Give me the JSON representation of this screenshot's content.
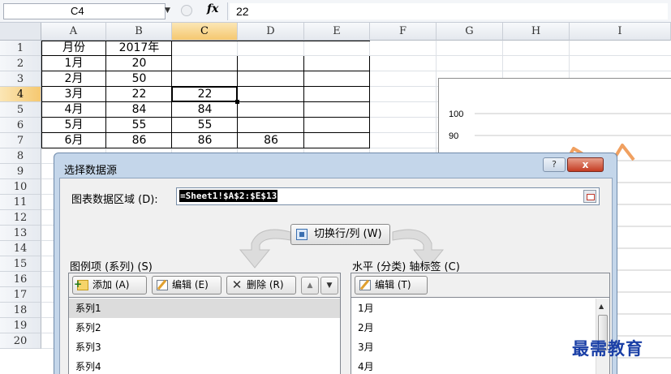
{
  "formula_bar": {
    "name_box": "C4",
    "fx_label": "fx",
    "formula_value": "22"
  },
  "sheet": {
    "columns": [
      "A",
      "B",
      "C",
      "D",
      "E",
      "F",
      "G",
      "H",
      "I"
    ],
    "rows": [
      "1",
      "2",
      "3",
      "4",
      "5",
      "6",
      "7",
      "8",
      "9",
      "10",
      "11",
      "12",
      "13",
      "14",
      "15",
      "16",
      "17",
      "18",
      "19",
      "20"
    ],
    "selected_column": "C",
    "selected_row": "4",
    "cells": [
      {
        "ref": "A1",
        "value": "月份"
      },
      {
        "ref": "B1",
        "value": "2017年"
      },
      {
        "ref": "A2",
        "value": "1月"
      },
      {
        "ref": "B2",
        "value": "20"
      },
      {
        "ref": "A3",
        "value": "2月"
      },
      {
        "ref": "B3",
        "value": "50"
      },
      {
        "ref": "A4",
        "value": "3月"
      },
      {
        "ref": "B4",
        "value": "22"
      },
      {
        "ref": "C4",
        "value": "22"
      },
      {
        "ref": "A5",
        "value": "4月"
      },
      {
        "ref": "B5",
        "value": "84"
      },
      {
        "ref": "C5",
        "value": "84"
      },
      {
        "ref": "A6",
        "value": "5月"
      },
      {
        "ref": "B6",
        "value": "55"
      },
      {
        "ref": "C6",
        "value": "55"
      },
      {
        "ref": "A7",
        "value": "6月"
      },
      {
        "ref": "B7",
        "value": "86"
      },
      {
        "ref": "C7",
        "value": "86"
      },
      {
        "ref": "D7",
        "value": "86"
      }
    ]
  },
  "chart": {
    "tick_labels": [
      "100",
      "90"
    ],
    "line_color": "#f0a060"
  },
  "dialog": {
    "title": "选择数据源",
    "help_label": "?",
    "close_label": "x",
    "range_label": "图表数据区域 (D):",
    "range_value": "=Sheet1!$A$2:$E$13",
    "switch_label": "切换行/列 (W)",
    "legend_section": {
      "label": "图例项 (系列) (S)",
      "add_label": "添加 (A)",
      "edit_label": "编辑 (E)",
      "delete_label": "删除 (R)",
      "items": [
        "系列1",
        "系列2",
        "系列3",
        "系列4"
      ],
      "selected_index": 0
    },
    "axis_section": {
      "label": "水平 (分类) 轴标签 (C)",
      "edit_label": "编辑 (T)",
      "items": [
        "1月",
        "2月",
        "3月",
        "4月"
      ]
    }
  },
  "watermark": "最需教育"
}
